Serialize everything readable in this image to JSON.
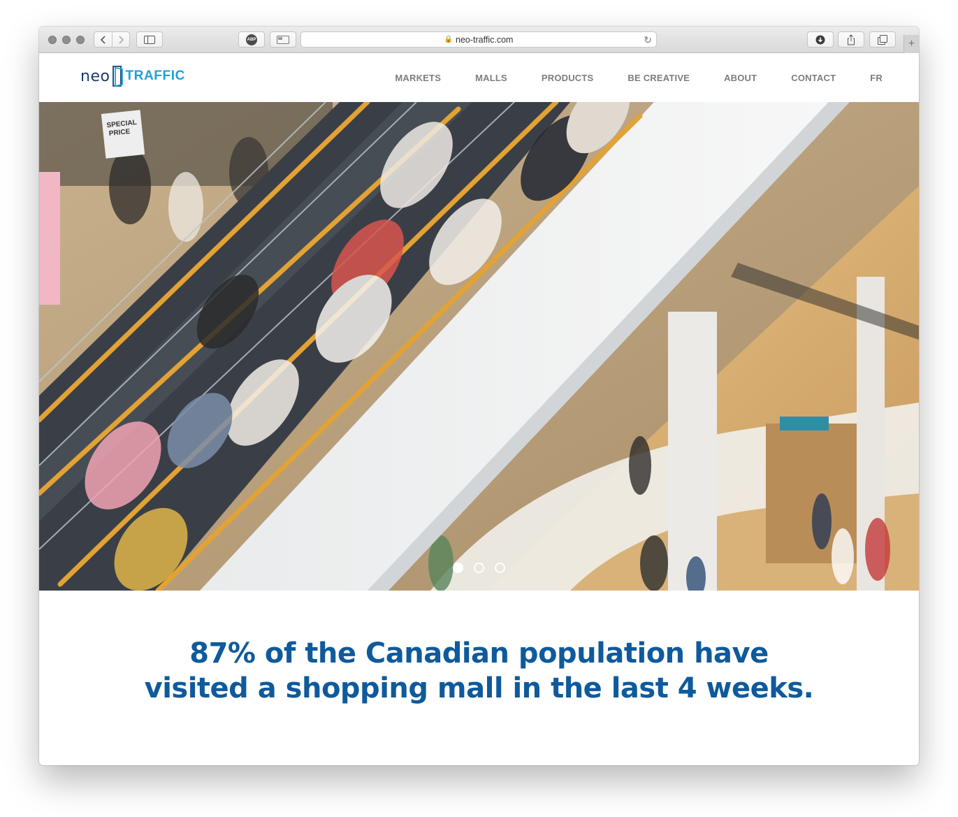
{
  "browser": {
    "url": "neo-traffic.com",
    "adblock_label": "ABP"
  },
  "site": {
    "logo": {
      "part1": "neo",
      "part2": "TRAFFIC"
    },
    "nav": [
      {
        "label": "MARKETS"
      },
      {
        "label": "MALLS"
      },
      {
        "label": "PRODUCTS"
      },
      {
        "label": "BE CREATIVE"
      },
      {
        "label": "ABOUT"
      },
      {
        "label": "CONTACT"
      },
      {
        "label": "FR"
      }
    ]
  },
  "hero": {
    "sign_text": "SPECIAL PRICE",
    "slides_total": 3,
    "active_slide": 1
  },
  "headline": {
    "text": "87% of the Canadian population have visited a shopping mall in the last 4 weeks."
  },
  "colors": {
    "brand_blue": "#0f5a9c",
    "logo_cyan": "#1da0e0",
    "nav_gray": "#7d7d7d"
  }
}
